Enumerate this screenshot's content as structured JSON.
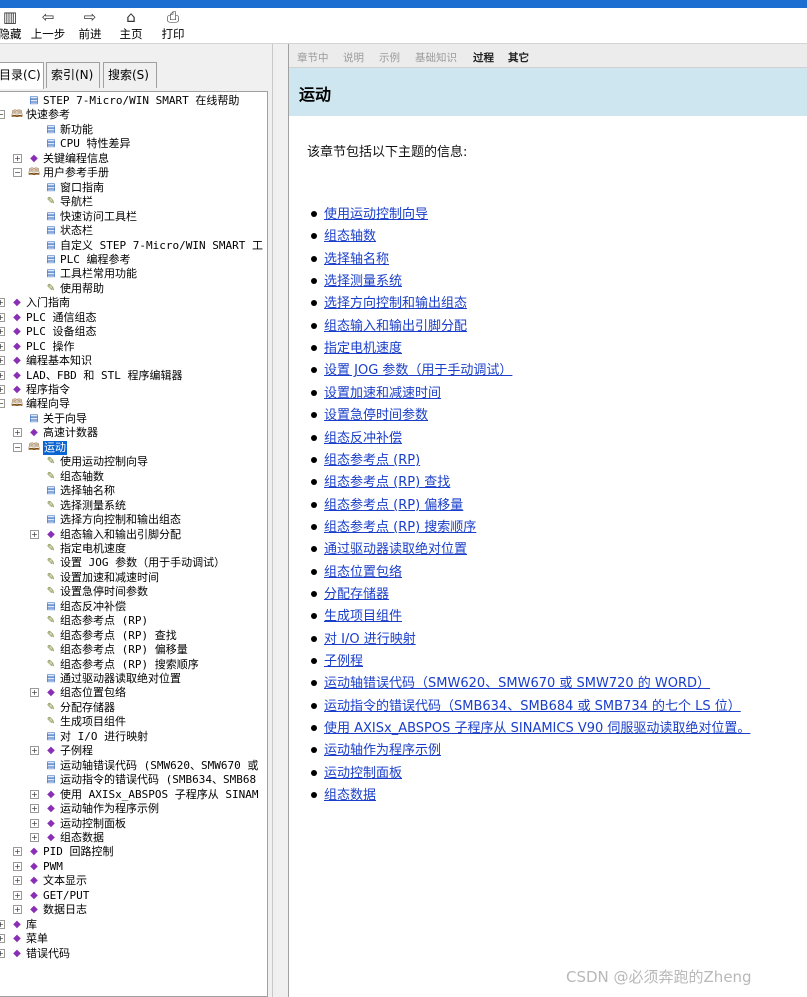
{
  "toolbar": {
    "hide_label": "隐藏",
    "back_label": "上一步",
    "forward_label": "前进",
    "home_label": "主页",
    "print_label": "打印",
    "icons": [
      "hide-icon",
      "back-arrow-icon",
      "forward-arrow-icon",
      "home-icon",
      "print-icon"
    ]
  },
  "tabs": [
    "目录(C)",
    "索引(N)",
    "搜索(S)"
  ],
  "tree": [
    {
      "label": "STEP 7-Micro/WIN SMART 在线帮助",
      "icon": "page",
      "expander": ""
    },
    {
      "label": "快速参考",
      "icon": "bopen",
      "expander": "−"
    },
    {
      "label": "新功能",
      "icon": "page",
      "expander": ""
    },
    {
      "label": "CPU 特性差异",
      "icon": "page",
      "expander": ""
    },
    {
      "label": "关键编程信息",
      "icon": "book",
      "expander": "+"
    },
    {
      "label": "用户参考手册",
      "icon": "bopen",
      "expander": "−"
    },
    {
      "label": "窗口指南",
      "icon": "page",
      "expander": ""
    },
    {
      "label": "导航栏",
      "icon": "q",
      "expander": ""
    },
    {
      "label": "快速访问工具栏",
      "icon": "page",
      "expander": ""
    },
    {
      "label": "状态栏",
      "icon": "page",
      "expander": ""
    },
    {
      "label": "自定义 STEP 7-Micro/WIN SMART 工",
      "icon": "page",
      "expander": ""
    },
    {
      "label": "PLC 编程参考",
      "icon": "page",
      "expander": ""
    },
    {
      "label": "工具栏常用功能",
      "icon": "page",
      "expander": ""
    },
    {
      "label": "使用帮助",
      "icon": "q",
      "expander": ""
    },
    {
      "label": "入门指南",
      "icon": "book",
      "expander": "+"
    },
    {
      "label": "PLC 通信组态",
      "icon": "book",
      "expander": "+"
    },
    {
      "label": "PLC 设备组态",
      "icon": "book",
      "expander": "+"
    },
    {
      "label": "PLC 操作",
      "icon": "book",
      "expander": "+"
    },
    {
      "label": "编程基本知识",
      "icon": "book",
      "expander": "+"
    },
    {
      "label": "LAD、FBD 和 STL 程序编辑器",
      "icon": "book",
      "expander": "+"
    },
    {
      "label": "程序指令",
      "icon": "book",
      "expander": "+"
    },
    {
      "label": "编程向导",
      "icon": "bopen",
      "expander": "−"
    },
    {
      "label": "关于向导",
      "icon": "page",
      "expander": ""
    },
    {
      "label": "高速计数器",
      "icon": "book",
      "expander": "+"
    },
    {
      "label": "运动",
      "icon": "bopen",
      "expander": "−",
      "selected": true
    },
    {
      "label": "使用运动控制向导",
      "icon": "q",
      "expander": ""
    },
    {
      "label": "组态轴数",
      "icon": "q",
      "expander": ""
    },
    {
      "label": "选择轴名称",
      "icon": "page",
      "expander": ""
    },
    {
      "label": "选择测量系统",
      "icon": "q",
      "expander": ""
    },
    {
      "label": "选择方向控制和输出组态",
      "icon": "page",
      "expander": ""
    },
    {
      "label": "组态输入和输出引脚分配",
      "icon": "book",
      "expander": "+"
    },
    {
      "label": "指定电机速度",
      "icon": "q",
      "expander": ""
    },
    {
      "label": "设置 JOG 参数（用于手动调试）",
      "icon": "q",
      "expander": ""
    },
    {
      "label": "设置加速和减速时间",
      "icon": "q",
      "expander": ""
    },
    {
      "label": "设置急停时间参数",
      "icon": "q",
      "expander": ""
    },
    {
      "label": "组态反冲补偿",
      "icon": "page",
      "expander": ""
    },
    {
      "label": "组态参考点 (RP)",
      "icon": "q",
      "expander": ""
    },
    {
      "label": "组态参考点 (RP) 查找",
      "icon": "q",
      "expander": ""
    },
    {
      "label": "组态参考点 (RP) 偏移量",
      "icon": "q",
      "expander": ""
    },
    {
      "label": "组态参考点 (RP) 搜索顺序",
      "icon": "q",
      "expander": ""
    },
    {
      "label": "通过驱动器读取绝对位置",
      "icon": "page",
      "expander": ""
    },
    {
      "label": "组态位置包络",
      "icon": "book",
      "expander": "+"
    },
    {
      "label": "分配存储器",
      "icon": "q",
      "expander": ""
    },
    {
      "label": "生成项目组件",
      "icon": "q",
      "expander": ""
    },
    {
      "label": "对 I/O 进行映射",
      "icon": "page",
      "expander": ""
    },
    {
      "label": "子例程",
      "icon": "book",
      "expander": "+"
    },
    {
      "label": "运动轴错误代码 (SMW620、SMW670 或",
      "icon": "page",
      "expander": ""
    },
    {
      "label": "运动指令的错误代码 (SMB634、SMB68",
      "icon": "page",
      "expander": ""
    },
    {
      "label": "使用 AXISx_ABSPOS 子程序从 SINAM",
      "icon": "book",
      "expander": "+"
    },
    {
      "label": "运动轴作为程序示例",
      "icon": "book",
      "expander": "+"
    },
    {
      "label": "运动控制面板",
      "icon": "book",
      "expander": "+"
    },
    {
      "label": "组态数据",
      "icon": "book",
      "expander": "+"
    },
    {
      "label": "PID 回路控制",
      "icon": "book",
      "expander": "+"
    },
    {
      "label": "PWM",
      "icon": "book",
      "expander": "+"
    },
    {
      "label": "文本显示",
      "icon": "book",
      "expander": "+"
    },
    {
      "label": "GET/PUT",
      "icon": "book",
      "expander": "+"
    },
    {
      "label": "数据日志",
      "icon": "book",
      "expander": "+"
    },
    {
      "label": "库",
      "icon": "book",
      "expander": "+"
    },
    {
      "label": "菜单",
      "icon": "book",
      "expander": "+"
    },
    {
      "label": "错误代码",
      "icon": "book",
      "expander": "+"
    }
  ],
  "nav": [
    {
      "label": "章节中",
      "active": false
    },
    {
      "label": "说明",
      "active": false
    },
    {
      "label": "示例",
      "active": false
    },
    {
      "label": "基础知识",
      "active": false
    },
    {
      "label": "过程",
      "active": true
    },
    {
      "label": "其它",
      "active": true
    }
  ],
  "page": {
    "title": "运动",
    "intro": "该章节包括以下主题的信息:",
    "links": [
      "使用运动控制向导",
      "组态轴数",
      "选择轴名称",
      "选择测量系统",
      "选择方向控制和输出组态",
      "组态输入和输出引脚分配",
      "指定电机速度",
      "设置 JOG 参数（用于手动调试）",
      "设置加速和减速时间",
      "设置急停时间参数",
      "组态反冲补偿",
      "组态参考点 (RP)",
      "组态参考点 (RP) 查找",
      "组态参考点 (RP) 偏移量",
      "组态参考点 (RP) 搜索顺序",
      "通过驱动器读取绝对位置",
      "组态位置包络",
      "分配存储器",
      "生成项目组件",
      "对 I/O 进行映射",
      "子例程",
      "运动轴错误代码（SMW620、SMW670 或 SMW720 的 WORD）",
      "运动指令的错误代码（SMB634、SMB684 或 SMB734 的七个 LS 位）",
      "使用 AXISx_ABSPOS 子程序从 SINAMICS V90 伺服驱动读取绝对位置。",
      "运动轴作为程序示例",
      "运动控制面板",
      "组态数据"
    ]
  },
  "watermark": "CSDN @必须奔跑的Zheng",
  "colors": {
    "link": "#1a3ec9",
    "header_bg": "#cde6ef",
    "selection": "#0a64d2",
    "titlebar": "#1c6fd1"
  }
}
